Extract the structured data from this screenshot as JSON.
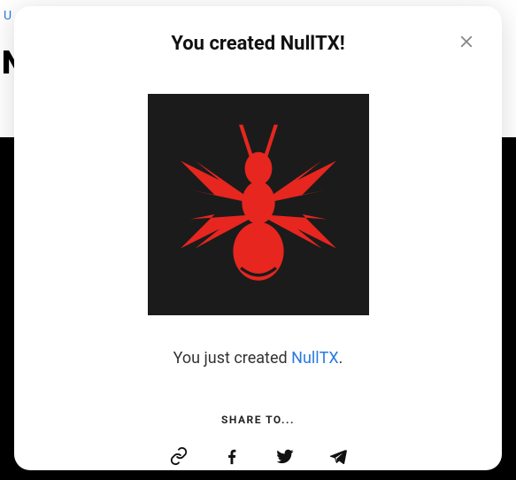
{
  "background": {
    "top_link": "U",
    "big_letter": "N"
  },
  "modal": {
    "title": "You created NullTX!",
    "subtitle_prefix": "You just created ",
    "subtitle_link": "NullTX",
    "subtitle_suffix": ".",
    "share_label": "SHARE TO...",
    "icons": {
      "link": "link-icon",
      "facebook": "facebook-icon",
      "twitter": "twitter-icon",
      "telegram": "telegram-icon"
    }
  }
}
